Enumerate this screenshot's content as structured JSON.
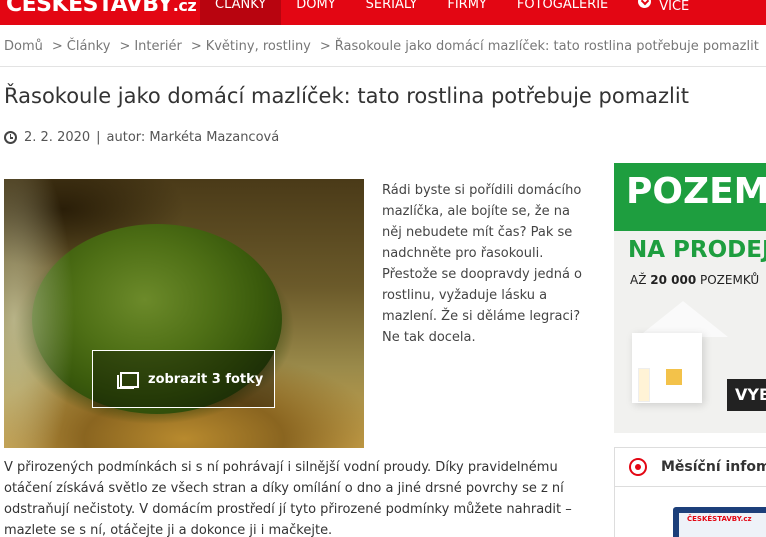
{
  "site": {
    "logo_main": "ČESKÉSTAVBY",
    "logo_tld": ".cz",
    "nav": [
      {
        "label": "ČLÁNKY",
        "active": true
      },
      {
        "label": "DOMY",
        "active": false
      },
      {
        "label": "SERIÁLY",
        "active": false
      },
      {
        "label": "FIRMY",
        "active": false
      },
      {
        "label": "FOTOGALERIE",
        "active": false
      },
      {
        "label": "VÍCE",
        "active": false,
        "icon": "chevron-down-icon"
      }
    ],
    "accent_color": "#e30613"
  },
  "breadcrumb": [
    "Domů",
    "Články",
    "Interiér",
    "Květiny, rostliny",
    "Řasokoule jako domácí mazlíček: tato rostlina potřebuje pomazlit"
  ],
  "article": {
    "title": "Řasokoule jako domácí mazlíček: tato rostlina potřebuje pomazlit",
    "date": "2. 2. 2020",
    "meta_sep": "|",
    "author_label": "autor: Markéta Mazancová",
    "gallery_button": "zobrazit 3 fotky",
    "lead": "Rádi byste si pořídili domácího mazlíčka, ale bojíte se, že na něj nebudete mít čas? Pak se nadchněte pro řasokouli. Přestože se doopravdy jedná o rostlinu, vyžaduje lásku a mazlení. Že si děláme legraci? Ne tak docela.",
    "body": "V přirozených podmínkách si s ní pohrávají i silnější vodní proudy. Díky pravidelnému otáčení získává světlo ze všech stran a díky omílání o dno a jiné drsné povrchy se z ní odstraňují nečistoty. V domácím prostředí jí tyto přirozené podmínky můžete nahradit – mazlete se s ní, otáčejte ji a dokonce ji i mačkejte."
  },
  "ad": {
    "headline": "POZEM",
    "subline": "NA PRODEJ",
    "detail_prefix": "AŽ ",
    "detail_bold": "20 000",
    "detail_suffix": " POZEMKŮ",
    "cta": "VYB",
    "brand_color": "#1e9e3f"
  },
  "sidebar": {
    "monthly_label": "Měsíční infom",
    "thumb_text": "ČESKÉSTAVBY.cz"
  }
}
